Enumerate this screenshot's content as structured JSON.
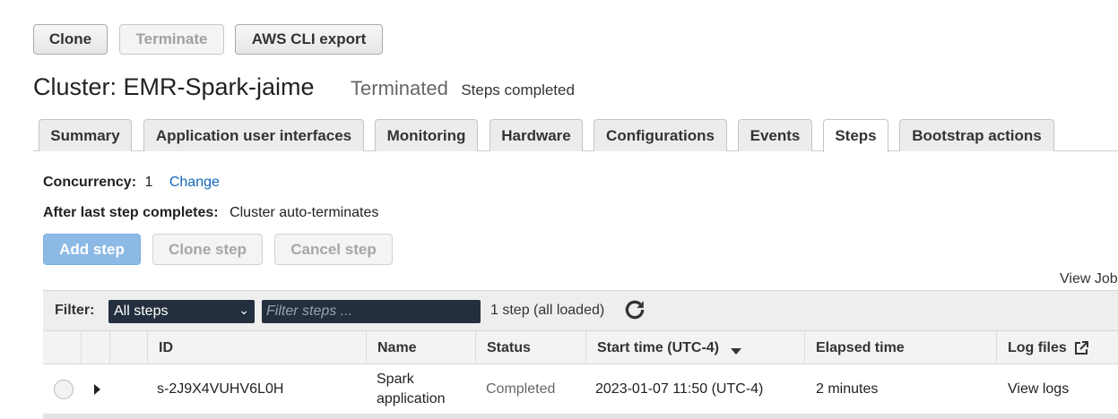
{
  "toolbar": {
    "clone": "Clone",
    "terminate": "Terminate",
    "cli_export": "AWS CLI export"
  },
  "cluster": {
    "title": "Cluster: EMR-Spark-jaime",
    "state": "Terminated",
    "state_detail": "Steps completed"
  },
  "tabs": [
    {
      "label": "Summary"
    },
    {
      "label": "Application user interfaces"
    },
    {
      "label": "Monitoring"
    },
    {
      "label": "Hardware"
    },
    {
      "label": "Configurations"
    },
    {
      "label": "Events"
    },
    {
      "label": "Steps",
      "active": true
    },
    {
      "label": "Bootstrap actions"
    }
  ],
  "steps_panel": {
    "concurrency_label": "Concurrency:",
    "concurrency_value": "1",
    "change_link": "Change",
    "after_label": "After last step completes:",
    "after_value": "Cluster auto-terminates",
    "add_step": "Add step",
    "clone_step": "Clone step",
    "cancel_step": "Cancel step",
    "view_jobs": "View Jobs"
  },
  "filter": {
    "label": "Filter:",
    "selected": "All steps",
    "placeholder": "Filter steps ...",
    "count": "1 step (all loaded)"
  },
  "table": {
    "columns": [
      "ID",
      "Name",
      "Status",
      "Start time (UTC-4)",
      "Elapsed time",
      "Log files"
    ],
    "rows": [
      {
        "id": "s-2J9X4VUHV6L0H",
        "name_line1": "Spark",
        "name_line2": "application",
        "status": "Completed",
        "start_time": "2023-01-07 11:50 (UTC-4)",
        "elapsed": "2 minutes",
        "logs": "View logs"
      }
    ]
  },
  "icons": {
    "refresh": "refresh-icon",
    "external": "external-link-icon",
    "sort": "sort-down-icon"
  },
  "colors": {
    "link": "#1066bb",
    "primary_button": "#8cb9e6",
    "filter_bg": "#232f3e"
  }
}
